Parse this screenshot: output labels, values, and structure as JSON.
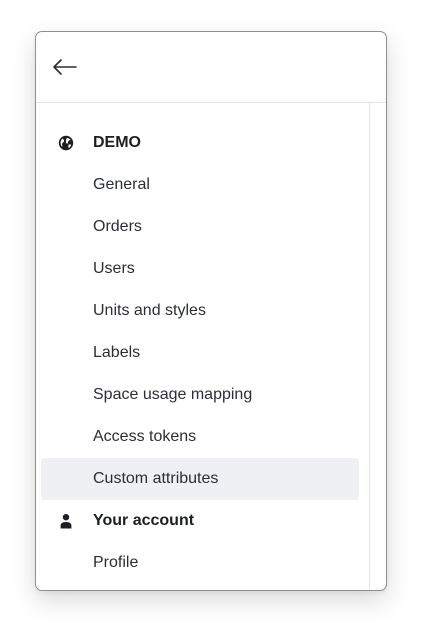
{
  "header": {
    "back_icon": "arrow-left-icon"
  },
  "menu": {
    "sections": [
      {
        "title": "DEMO",
        "icon": "globe-icon",
        "items": [
          {
            "label": "General"
          },
          {
            "label": "Orders"
          },
          {
            "label": "Users"
          },
          {
            "label": "Units and styles"
          },
          {
            "label": "Labels"
          },
          {
            "label": "Space usage mapping"
          },
          {
            "label": "Access tokens"
          },
          {
            "label": "Custom attributes",
            "selected": true
          }
        ]
      },
      {
        "title": "Your account",
        "icon": "person-icon",
        "items": [
          {
            "label": "Profile"
          }
        ]
      }
    ]
  },
  "colors": {
    "text": "#2a2e35",
    "selected_background": "#eef0f3",
    "border": "#8a8f98",
    "divider": "#e2e4e8"
  }
}
